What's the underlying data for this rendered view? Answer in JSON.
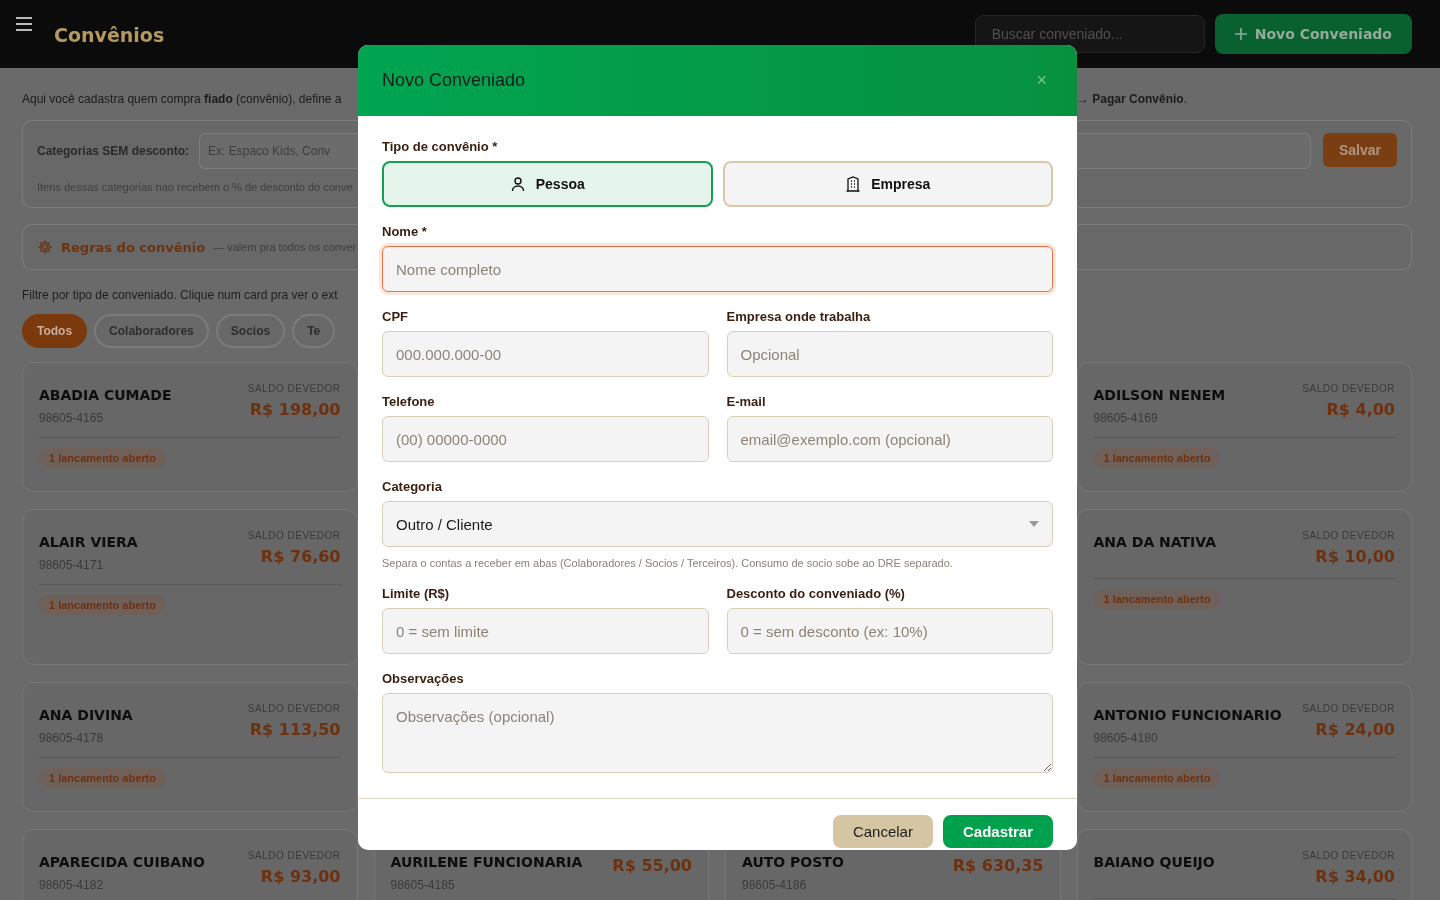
{
  "header": {
    "title": "Convênios",
    "search": {
      "placeholder": "Buscar conveniado..."
    },
    "new_button": "Novo Conveniado"
  },
  "intro": {
    "left": "Aqui você cadastra quem compra **fiado** (convênio), define a",
    "right": "→ **Pagar Convênio**."
  },
  "categories_box": {
    "label": "Categorias SEM desconto:",
    "placeholder": "Ex: Espaco Kids, Conv",
    "note": "Itens dessas categorias nao recebem o % de desconto do conve",
    "save_button": "Salvar"
  },
  "rules_box": {
    "title": "Regras do convênio",
    "subtitle": "— valem pra todos os conver"
  },
  "filter_text": "Filtre por tipo de conveniado. Clique num card pra ver o ext",
  "filters": [
    {
      "label": "Todos",
      "selected": true
    },
    {
      "label": "Colaboradores",
      "selected": false
    },
    {
      "label": "Socios",
      "selected": false
    },
    {
      "label": "Te",
      "selected": false
    }
  ],
  "card_columns": [
    {
      "cards": [
        {
          "name": "ABADIA CUMADE",
          "phone": "98605-4165",
          "balance_label": "SALDO DEVEDOR",
          "balance": "R$ 198,00",
          "tag": "1 lancamento aberto"
        },
        {
          "name": "ALAIR VIERA",
          "phone": "98605-4171",
          "balance_label": "SALDO DEVEDOR",
          "balance": "R$ 76,60",
          "tag": "1 lancamento aberto"
        },
        {
          "name": "ANA DIVINA",
          "phone": "98605-4178",
          "balance_label": "SALDO DEVEDOR",
          "balance": "R$ 113,50",
          "tag": "1 lancamento aberto"
        },
        {
          "name": "APARECIDA CUIBANO",
          "phone": "98605-4182",
          "balance_label": "SALDO DEVEDOR",
          "balance": "R$ 93,00"
        }
      ]
    },
    {
      "cards": [
        {
          "name": "AURILENE FUNCIONARIA",
          "phone": "98605-4185",
          "balance": "R$ 55,00"
        }
      ]
    },
    {
      "cards": [
        {
          "name": "AUTO POSTO",
          "phone": "98605-4186",
          "balance": "R$ 630,35"
        }
      ]
    },
    {
      "cards": [
        {
          "name": "ADILSON NENEM",
          "phone": "98605-4169",
          "balance_label": "SALDO DEVEDOR",
          "balance": "R$ 4,00",
          "tag": "1 lancamento aberto"
        },
        {
          "name": "ANA DA NATIVA",
          "balance_label": "SALDO DEVEDOR",
          "balance": "R$ 10,00",
          "tag": "1 lancamento aberto"
        },
        {
          "name": "ANTONIO FUNCIONARIO",
          "phone": "98605-4180",
          "balance_label": "SALDO DEVEDOR",
          "balance": "R$ 24,00",
          "tag": "1 lancamento aberto"
        },
        {
          "name": "BAIANO QUEIJO",
          "balance_label": "SALDO DEVEDOR",
          "balance": "R$ 34,00"
        }
      ]
    }
  ],
  "modal": {
    "title": "Novo Conveniado",
    "close": "×",
    "type_label": "Tipo de convênio *",
    "types": [
      {
        "label": "Pessoa",
        "kind": "person",
        "selected": true
      },
      {
        "label": "Empresa",
        "kind": "company",
        "selected": false
      }
    ],
    "rows": [
      {
        "fields": [
          {
            "label": "Nome *",
            "kind": "text",
            "placeholder": "Nome completo",
            "focused": true
          }
        ]
      },
      {
        "fields": [
          {
            "label": "CPF",
            "kind": "text",
            "placeholder": "000.000.000-00",
            "focused": false
          },
          {
            "label": "Empresa onde trabalha",
            "kind": "text",
            "placeholder": "Opcional",
            "focused": false
          }
        ]
      },
      {
        "fields": [
          {
            "label": "Telefone",
            "kind": "text",
            "placeholder": "(00) 00000-0000",
            "focused": false
          },
          {
            "label": "E-mail",
            "kind": "text",
            "placeholder": "email@exemplo.com (opcional)",
            "focused": false
          }
        ]
      },
      {
        "fields": [
          {
            "label": "Categoria",
            "kind": "select",
            "value": "Outro / Cliente",
            "hint": "Separa o contas a receber em abas (Colaboradores / Socios / Terceiros). Consumo de socio sobe ao DRE separado.",
            "focused": false
          }
        ]
      },
      {
        "fields": [
          {
            "label": "Limite (R$)",
            "kind": "text",
            "placeholder": "0 = sem limite",
            "focused": false
          },
          {
            "label": "Desconto do conveniado (%)",
            "kind": "text",
            "placeholder": "0 = sem desconto (ex: 10%)",
            "focused": false
          }
        ]
      },
      {
        "fields": [
          {
            "label": "Observações",
            "kind": "textarea",
            "placeholder": "Observações (opcional)",
            "focused": false
          }
        ]
      }
    ],
    "buttons": [
      {
        "label": "Cancelar",
        "kind": "secondary"
      },
      {
        "label": "Cadastrar",
        "kind": "primary"
      }
    ]
  }
}
